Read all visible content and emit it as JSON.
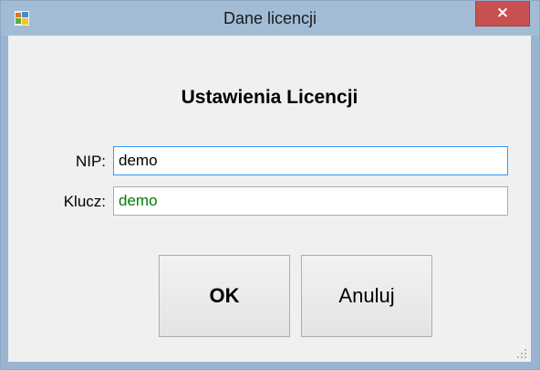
{
  "window": {
    "title": "Dane licencji",
    "close_symbol": "×",
    "icon": "app-icon"
  },
  "form": {
    "heading": "Ustawienia Licencji",
    "nip_label": "NIP:",
    "nip_value": "demo",
    "key_label": "Klucz:",
    "key_value": "demo"
  },
  "buttons": {
    "ok_label": "OK",
    "cancel_label": "Anuluj"
  },
  "colors": {
    "titlebar": "#a3bcd6",
    "close_button": "#c75050",
    "client_background": "#f0f0f0",
    "focus_border": "#3399ff",
    "key_text": "#008000"
  }
}
